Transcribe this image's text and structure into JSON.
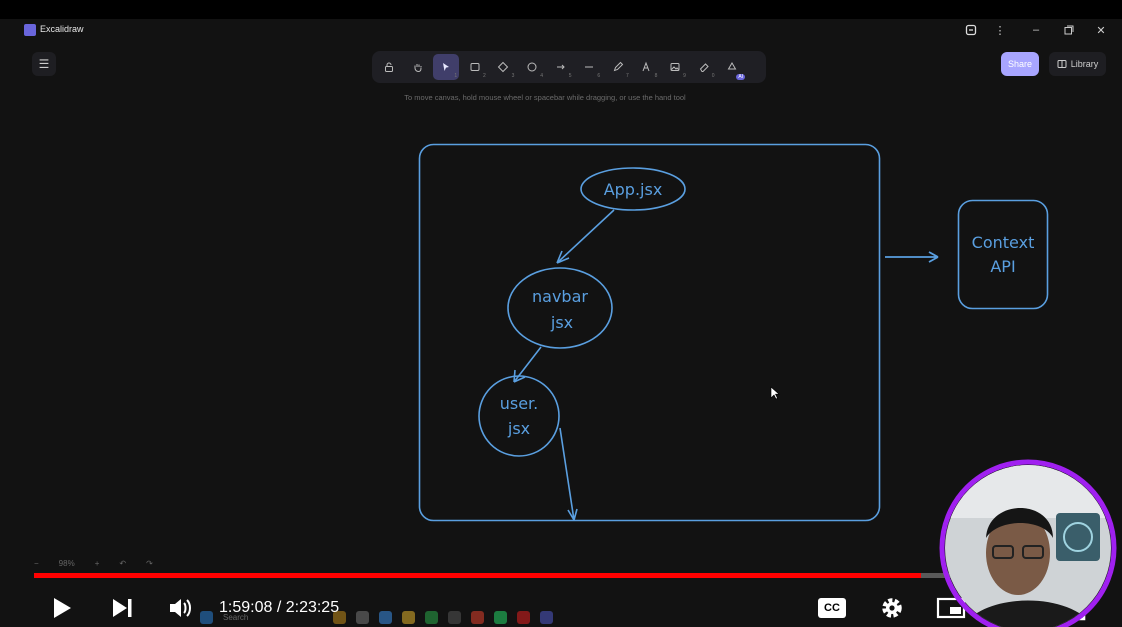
{
  "app": {
    "title": "Excalidraw"
  },
  "window_controls": [
    "layout-icon",
    "more-icon",
    "minimize-icon",
    "maximize-icon",
    "close-icon"
  ],
  "toolbar": {
    "tools": [
      {
        "name": "lock",
        "key": ""
      },
      {
        "name": "hand",
        "key": ""
      },
      {
        "name": "selection",
        "key": "1",
        "active": true
      },
      {
        "name": "rectangle",
        "key": "2"
      },
      {
        "name": "diamond",
        "key": "3"
      },
      {
        "name": "ellipse",
        "key": "4"
      },
      {
        "name": "arrow",
        "key": "5"
      },
      {
        "name": "line",
        "key": "6"
      },
      {
        "name": "draw",
        "key": "7"
      },
      {
        "name": "text",
        "key": "8"
      },
      {
        "name": "image",
        "key": "9"
      },
      {
        "name": "eraser",
        "key": "0"
      },
      {
        "name": "ai-magic",
        "key": "",
        "badge": "AI"
      }
    ]
  },
  "hint": "To move canvas, hold mouse wheel or spacebar while dragging, or use the hand tool",
  "share_label": "Share",
  "library_label": "Library",
  "diagram": {
    "nodes": {
      "app": "App.jsx",
      "navbar_line1": "navbar",
      "navbar_line2": "jsx",
      "user_line1": "user.",
      "user_line2": "jsx",
      "context_line1": "Context",
      "context_line2": "API"
    }
  },
  "zoom": {
    "value": "98%",
    "minus": "−",
    "plus": "+"
  },
  "player": {
    "time": "1:59:08 / 2:23:25",
    "progress": 0.829,
    "cc_label": "CC"
  },
  "taskbar": {
    "search_placeholder": "Search"
  },
  "colors": {
    "sketch_blue": "#5a9fe0",
    "accent": "#a8a5ff",
    "progress_red": "#ff0000",
    "canvas_bg": "#121212"
  }
}
